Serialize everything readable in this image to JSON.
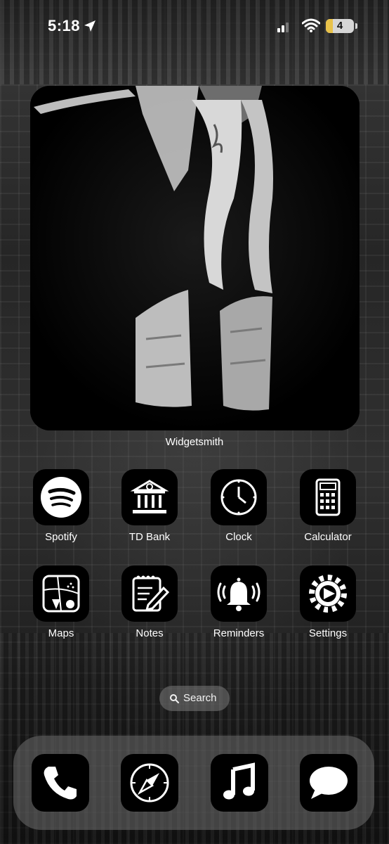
{
  "status_bar": {
    "time": "5:18",
    "battery": "4",
    "accent_battery_color": "#e8c24a"
  },
  "widget": {
    "label": "Widgetsmith"
  },
  "apps": {
    "spotify": "Spotify",
    "td_bank": "TD Bank",
    "clock": "Clock",
    "calculator": "Calculator",
    "maps": "Maps",
    "notes": "Notes",
    "reminders": "Reminders",
    "settings": "Settings"
  },
  "search": {
    "label": "Search"
  },
  "dock": {
    "icons": [
      "phone-icon",
      "safari-compass-icon",
      "music-note-icon",
      "messages-bubble-icon"
    ]
  }
}
